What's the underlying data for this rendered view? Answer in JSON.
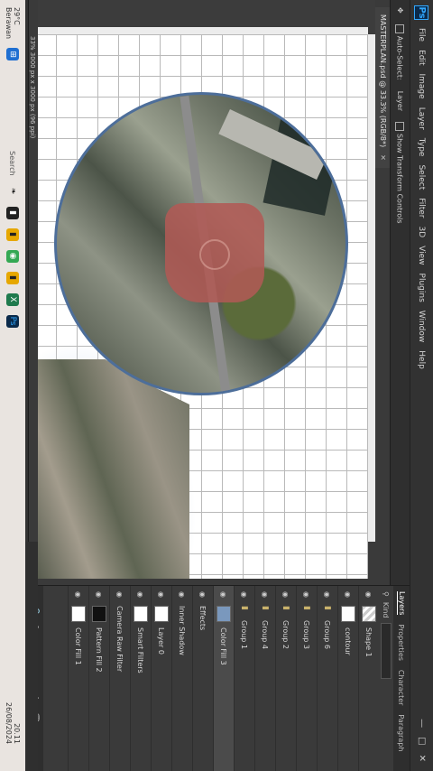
{
  "menubar": {
    "logo": "Ps",
    "items": [
      "File",
      "Edit",
      "Image",
      "Layer",
      "Type",
      "Select",
      "Filter",
      "3D",
      "View",
      "Plugins",
      "Window",
      "Help"
    ]
  },
  "optbar": {
    "auto_select": "Auto-Select:",
    "target": "Layer",
    "show_transform": "Show Transform Controls"
  },
  "document": {
    "tab_title": "MASTERPLAN.psd @ 33.3% (RGB/8*)",
    "status": "33% 3000 px x 3000 px (96 ppi)"
  },
  "layers": {
    "tabs": [
      "Layers",
      "Properties",
      "Character",
      "Paragraph"
    ],
    "kind_label": "Kind",
    "rows": [
      {
        "name": "Shape 1",
        "thumb": "check"
      },
      {
        "name": "contour",
        "thumb": "white"
      },
      {
        "name": "Group 6",
        "thumb": "folder"
      },
      {
        "name": "Group 3",
        "thumb": "folder"
      },
      {
        "name": "Group 2",
        "thumb": "folder"
      },
      {
        "name": "Group 4",
        "thumb": "folder"
      },
      {
        "name": "Group 1",
        "thumb": "folder"
      },
      {
        "name": "Color Fill 3",
        "thumb": "blue"
      },
      {
        "name": "Effects",
        "thumb": "none"
      },
      {
        "name": "Inner Shadow",
        "thumb": "none"
      },
      {
        "name": "Layer 0",
        "thumb": "white"
      },
      {
        "name": "Smart Filters",
        "thumb": "white"
      },
      {
        "name": "Camera Raw Filter",
        "thumb": "none"
      },
      {
        "name": "Pattern Fill 2",
        "thumb": "dark"
      },
      {
        "name": "Color Fill 1",
        "thumb": "white"
      }
    ]
  },
  "taskbar": {
    "weather_temp": "29°C",
    "weather_desc": "Berawan",
    "search": "Search",
    "time": "20.11",
    "date": "26/08/2024"
  },
  "colors": {
    "ps_blue": "#31a8ff",
    "circle_border": "#4d6e9a",
    "plaza": "#b05a55"
  }
}
